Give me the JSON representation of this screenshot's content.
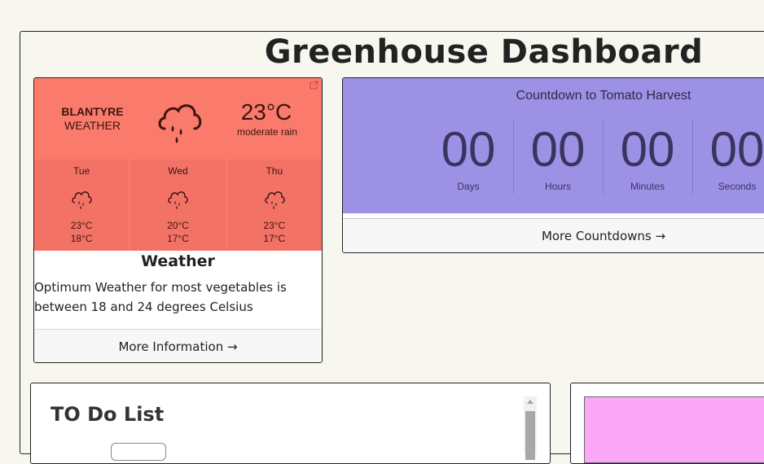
{
  "page": {
    "title": "Greenhouse Dashboard"
  },
  "weather": {
    "city": "BLANTYRE",
    "city_sub": "WEATHER",
    "current_temp": "23°C",
    "current_desc": "moderate rain",
    "current_icon": "rain-cloud-icon",
    "forecast": [
      {
        "day": "Tue",
        "high": "23°C",
        "low": "18°C",
        "icon": "rain-cloud-icon"
      },
      {
        "day": "Wed",
        "high": "20°C",
        "low": "17°C",
        "icon": "rain-cloud-icon"
      },
      {
        "day": "Thu",
        "high": "23°C",
        "low": "17°C",
        "icon": "rain-cloud-icon"
      }
    ],
    "heading": "Weather",
    "body": "Optimum Weather for most vegetables is between 18 and 24 degrees Celsius",
    "link": "More Information →",
    "color": "#fa7b6b"
  },
  "countdown": {
    "title": "Countdown to Tomato Harvest",
    "units": [
      {
        "value": "00",
        "label": "Days"
      },
      {
        "value": "00",
        "label": "Hours"
      },
      {
        "value": "00",
        "label": "Minutes"
      },
      {
        "value": "00",
        "label": "Seconds"
      }
    ],
    "link": "More Countdowns →",
    "color": "#9d91e6"
  },
  "todo": {
    "title": "TO Do List"
  },
  "colors": {
    "background": "#f7f6ef",
    "pink_block": "#fca8f8"
  }
}
